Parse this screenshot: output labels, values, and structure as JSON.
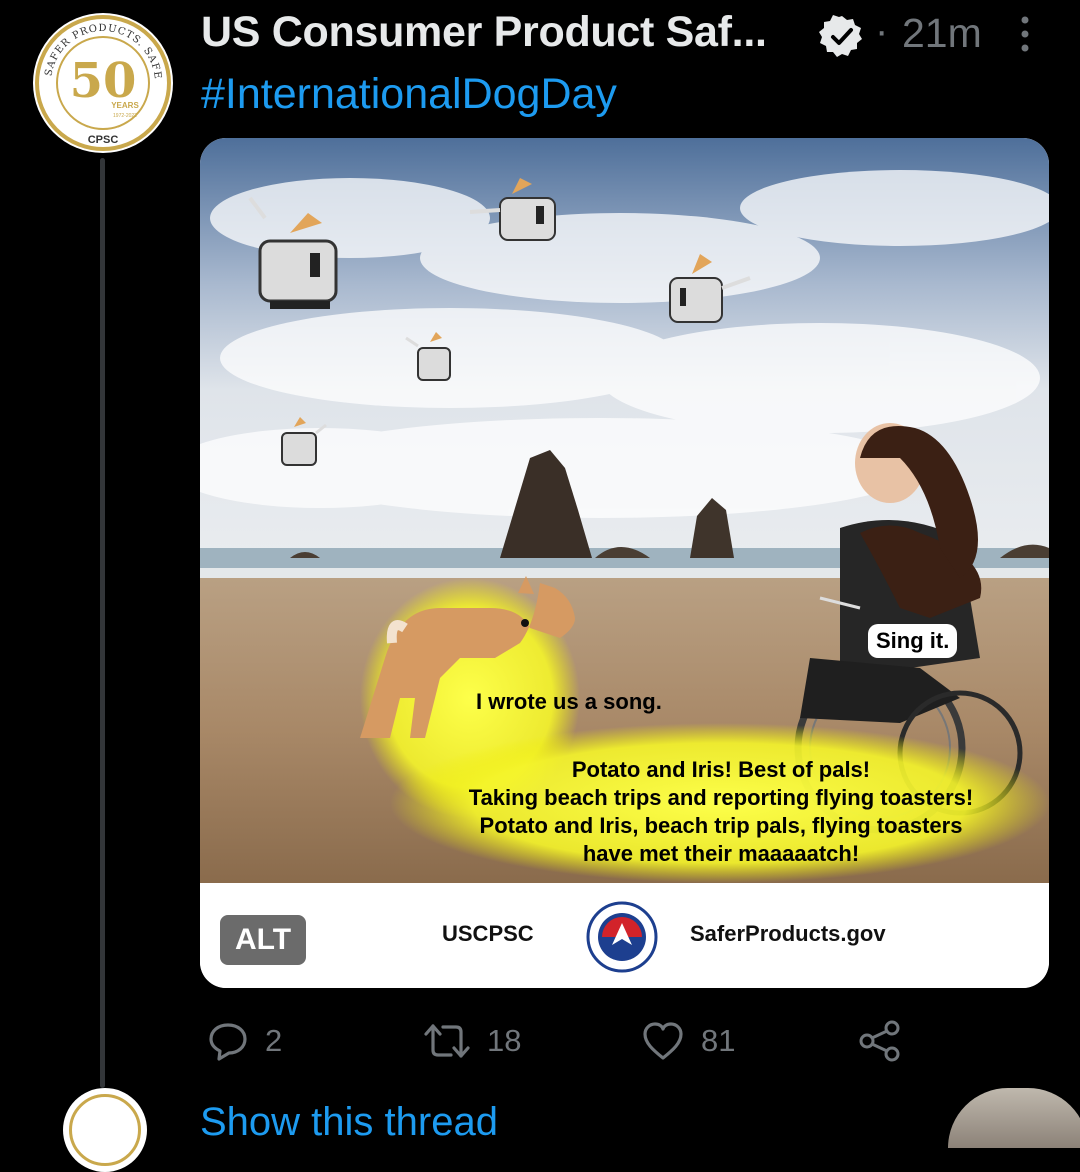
{
  "tweet": {
    "author_name": "US Consumer Product Saf...",
    "time_ago": "21m",
    "separator": "·",
    "text": "#InternationalDogDay",
    "avatar": {
      "anniversary_number": "50",
      "years_label": "YEARS",
      "year_range": "1972-2022",
      "ring_text": "SAFER PRODUCTS. SAFER PUBLIC.",
      "org_label": "CPSC"
    },
    "media": {
      "dog_speech": "I wrote us a song.",
      "song_lines": [
        "Potato and Iris! Best of pals!",
        "Taking beach trips and reporting flying toasters!",
        "Potato and Iris, beach trip pals, flying toasters",
        "have met their maaaaatch!"
      ],
      "iris_speech": "Sing it.",
      "alt_badge": "ALT",
      "brand_left": "USCPSC",
      "brand_right": "SaferProducts.gov"
    },
    "actions": {
      "replies": "2",
      "retweets": "18",
      "likes": "81"
    }
  },
  "next_tweet": {
    "text_peek": "Show this thread"
  },
  "colors": {
    "background": "#000000",
    "accent_link": "#1d9bf0",
    "muted": "#71767b",
    "text": "#e7e9ea",
    "cpsc_gold": "#c9a84c",
    "cpsc_red": "#d2232a",
    "cpsc_blue": "#1d3f8f"
  },
  "icons": [
    "verified-icon",
    "more-icon",
    "reply-icon",
    "retweet-icon",
    "like-icon",
    "share-icon"
  ]
}
